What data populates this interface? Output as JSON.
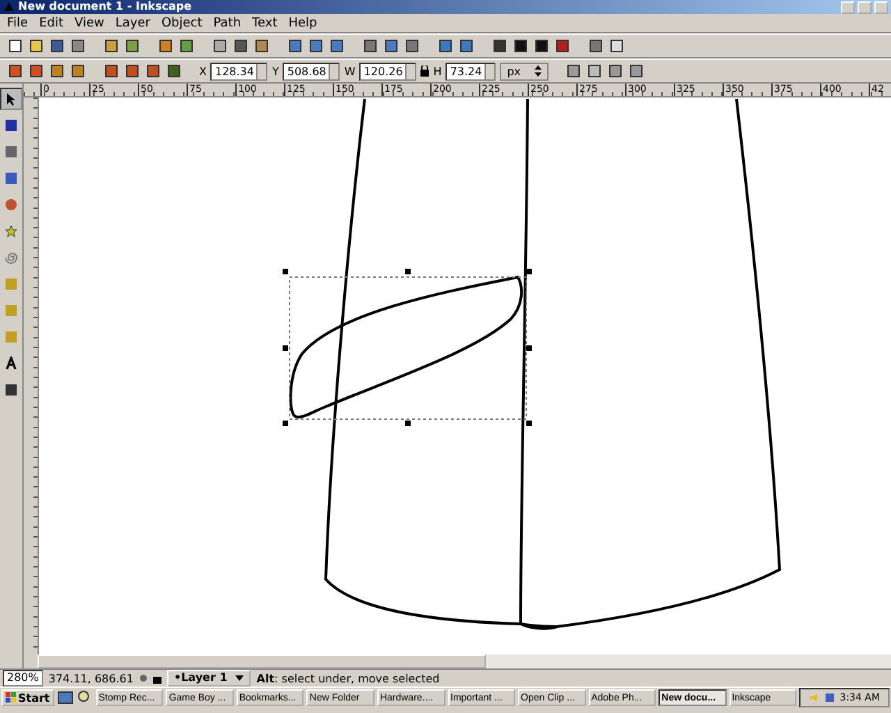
{
  "window": {
    "title": "New document 1 - Inkscape"
  },
  "menu": [
    "File",
    "Edit",
    "View",
    "Layer",
    "Object",
    "Path",
    "Text",
    "Help"
  ],
  "selector_toolbar": {
    "fields": [
      {
        "label": "X",
        "value": "128.34"
      },
      {
        "label": "Y",
        "value": "508.68"
      },
      {
        "label": "W",
        "value": "120.26"
      },
      {
        "label": "H",
        "value": "73.24"
      }
    ],
    "unit": "px"
  },
  "ruler": {
    "labels": [
      "0",
      "25",
      "50",
      "75",
      "100",
      "125",
      "150",
      "175",
      "200",
      "225",
      "250",
      "275",
      "300",
      "325",
      "350",
      "375",
      "400",
      "42"
    ]
  },
  "toolbox": [
    {
      "kind": "selector",
      "selected": true
    },
    {
      "kind": "node",
      "selected": false
    },
    {
      "kind": "zoom",
      "selected": false
    },
    {
      "kind": "rect",
      "selected": false
    },
    {
      "kind": "ellipse",
      "selected": false
    },
    {
      "kind": "star",
      "selected": false
    },
    {
      "kind": "spiral",
      "selected": false
    },
    {
      "kind": "pencil",
      "selected": false
    },
    {
      "kind": "pen",
      "selected": false
    },
    {
      "kind": "calligraphy",
      "selected": false
    },
    {
      "kind": "text",
      "selected": false
    },
    {
      "kind": "dropper",
      "selected": false
    }
  ],
  "status_bar": {
    "zoom": "280%",
    "coordinates": "374.11, 686.61",
    "layer": "•Layer 1",
    "message": "**Alt**: select under, move selected"
  },
  "taskbar": {
    "start": "Start",
    "buttons": [
      {
        "label": "Stomp Rec...",
        "selected": false
      },
      {
        "label": "Game Boy ...",
        "selected": false
      },
      {
        "label": "Bookmarks...",
        "selected": false
      },
      {
        "label": "New Folder",
        "selected": false
      },
      {
        "label": "Hardware....",
        "selected": false
      },
      {
        "label": "Important ...",
        "selected": false
      },
      {
        "label": "Open Clip ...",
        "selected": false
      },
      {
        "label": "Adobe Ph...",
        "selected": false
      },
      {
        "label": "New docu...",
        "selected": true
      },
      {
        "label": "Inkscape",
        "selected": false
      }
    ],
    "clock": "3:34 AM"
  }
}
